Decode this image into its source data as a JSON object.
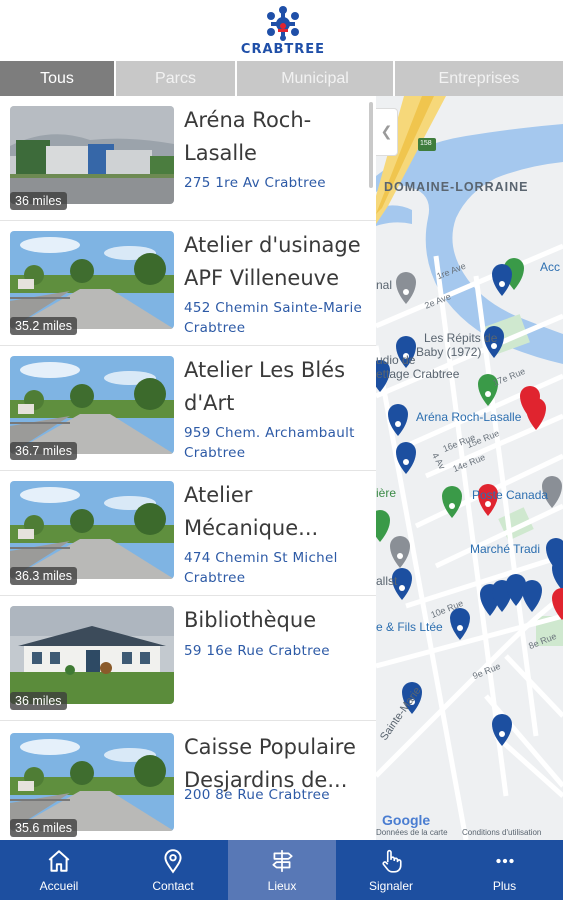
{
  "header": {
    "logo_text": "CRABTREE"
  },
  "tabs": [
    {
      "label": "Tous",
      "active": true
    },
    {
      "label": "Parcs",
      "active": false
    },
    {
      "label": "Municipal",
      "active": false
    },
    {
      "label": "Entreprises",
      "active": false
    }
  ],
  "places": [
    {
      "name": "Aréna Roch-Lasalle",
      "address": "275 1re Av Crabtree",
      "distance": "36 miles",
      "photo": "arena-photo"
    },
    {
      "name": "Atelier d'usinage APF Villeneuve",
      "address": "452 Chemin Sainte-Marie Crabtree",
      "distance": "35.2 miles",
      "photo": "street-photo"
    },
    {
      "name": "Atelier Les Blés d'Art",
      "address": "959 Chem. Archambault Crabtree",
      "distance": "36.7 miles",
      "photo": "street-photo"
    },
    {
      "name": "Atelier Mécanique...",
      "address": "474 Chemin St Michel Crabtree",
      "distance": "36.3 miles",
      "photo": "street-photo"
    },
    {
      "name": "Bibliothèque",
      "address": "59 16e Rue Crabtree",
      "distance": "36 miles",
      "photo": "library-photo"
    },
    {
      "name": "Caisse Populaire Desjardins de...",
      "address": "200 8e Rue Crabtree",
      "distance": "35.6 miles",
      "photo": "street-photo"
    }
  ],
  "map": {
    "labels": {
      "domaine": "DOMAINE-LORRAINE",
      "arena": "Aréna Roch-Lasalle",
      "poste": "Poste Canada",
      "marche": "Marché Tradi",
      "repits": "Les Répits de",
      "baby": "Baby (1972)",
      "studio": "udio de",
      "stylisme": "ettage Crabtree",
      "fils": "e & Fils Ltée",
      "route": "158",
      "acc": "Acc",
      "nal": "nal",
      "riere": "ière",
      "allst": "allst",
      "sainte_marie": "Sainte-Marie",
      "r1ave": "1re Ave",
      "r2ave": "2e Ave",
      "r12": "12e Rue",
      "r13": "13e Rue",
      "r14": "14e Rue",
      "r15": "15e Rue",
      "r16": "16e Rue",
      "r17": "17e Rue",
      "r10": "10e Rue",
      "r8": "8e Rue",
      "r9": "9e Rue",
      "road4av": "4 Av",
      "google": "Google",
      "donnees": "Données de la carte",
      "conditions": "Conditions d'utilisation"
    },
    "pin_colors": {
      "blue": "#1c4fa0",
      "red": "#e0242f",
      "green": "#3a9a48",
      "gray": "#8a8f96"
    }
  },
  "bottom_nav": [
    {
      "label": "Accueil",
      "icon": "home-icon",
      "active": false
    },
    {
      "label": "Contact",
      "icon": "location-pin-icon",
      "active": false
    },
    {
      "label": "Lieux",
      "icon": "signpost-icon",
      "active": true
    },
    {
      "label": "Signaler",
      "icon": "pointer-hand-icon",
      "active": false
    },
    {
      "label": "Plus",
      "icon": "more-dots-icon",
      "active": false
    }
  ]
}
